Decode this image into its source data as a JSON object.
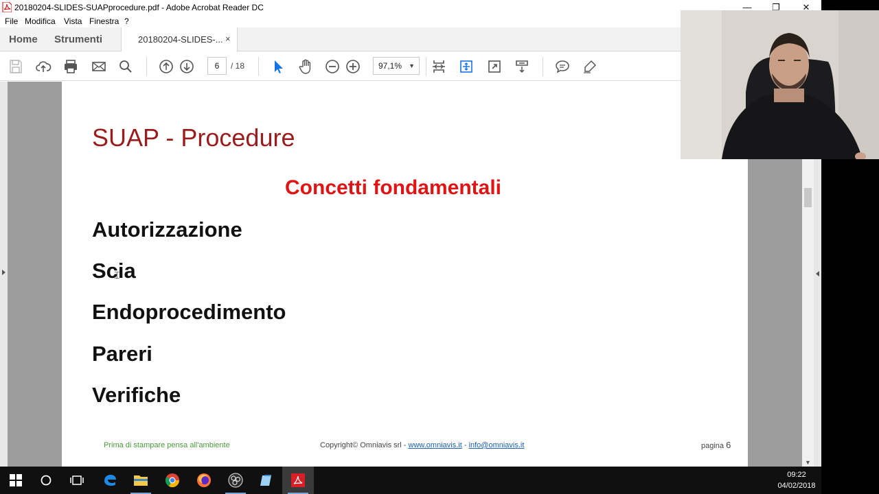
{
  "window": {
    "title": "20180204-SLIDES-SUAPprocedure.pdf - Adobe Acrobat Reader DC",
    "minimize_glyph": "—",
    "restore_glyph": "❐",
    "close_glyph": "✕"
  },
  "menu": [
    "File",
    "Modifica",
    "Vista",
    "Finestra",
    "?"
  ],
  "tabs": {
    "home": "Home",
    "tools": "Strumenti",
    "document": "20180204-SLIDES-...",
    "close_glyph": "×"
  },
  "toolbar": {
    "page_current": "6",
    "page_total": "/ 18",
    "zoom": "97,1%",
    "zoom_caret": "▼",
    "icons": [
      "save-icon",
      "upload-icon",
      "print-icon",
      "email-icon",
      "search-icon",
      "prev-page-icon",
      "next-page-icon",
      "select-cursor-icon",
      "hand-icon",
      "zoom-out-icon",
      "zoom-in-icon",
      "fit-page-icon",
      "scroll-mode-icon",
      "fullscreen-icon",
      "read-mode-icon",
      "comment-icon",
      "highlight-icon"
    ],
    "accent": "#1473e6"
  },
  "slide": {
    "title": "SUAP - Procedure",
    "subtitle": "Concetti fondamentali",
    "terms": [
      "Autorizzazione",
      "Scia",
      "Endoprocedimento",
      "Pareri",
      "Verifiche"
    ],
    "footer_left": "Prima di stampare pensa all'ambiente",
    "footer_copyright": "Copyright© Omniavis srl - ",
    "footer_link1": "www.omniavis.it",
    "footer_sep": " - ",
    "footer_link2": "info@omniavis.it",
    "footer_page_label": "pagina ",
    "footer_page_num": "6",
    "title_color": "#9b1c1c",
    "subtitle_color": "#e01414"
  },
  "taskbar": {
    "apps": [
      "windows-start-icon",
      "search-icon",
      "task-view-icon",
      "edge-icon",
      "file-explorer-icon",
      "chrome-icon",
      "firefox-icon",
      "obs-icon",
      "notepad-icon",
      "acrobat-icon"
    ],
    "time": "09:22",
    "date": "04/02/2018"
  }
}
